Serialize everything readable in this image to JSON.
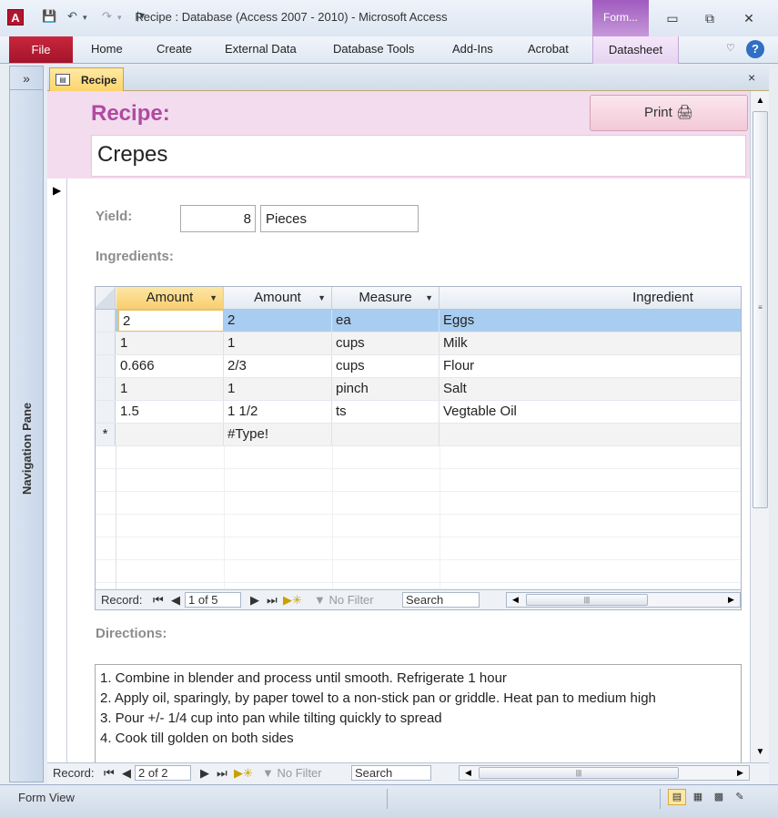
{
  "window": {
    "title": "Recipe : Database (Access 2007 - 2010)  -  Microsoft Access",
    "context_tab_group": "Form...",
    "app_icon": "A"
  },
  "ribbon": {
    "file_tab": "File",
    "tabs": [
      "Home",
      "Create",
      "External Data",
      "Database Tools",
      "Add-Ins",
      "Acrobat",
      "Datasheet"
    ]
  },
  "nav_pane": {
    "toggle": "»",
    "label": "Navigation Pane"
  },
  "document_tab": {
    "label": "Recipe",
    "close": "×"
  },
  "form": {
    "header_title": "Recipe:",
    "print_label": "Print",
    "recipe_name": "Crepes",
    "yield_label": "Yield:",
    "yield_amount": "8",
    "yield_unit": "Pieces",
    "ingredients_label": "Ingredients:",
    "directions_label": "Directions:",
    "directions_lines": [
      "1. Combine in blender and process until smooth.  Refrigerate 1 hour",
      "2. Apply oil, sparingly, by paper towel to a non-stick pan or griddle.  Heat pan to medium high",
      "3. Pour +/- 1/4 cup into pan while tilting quickly to spread",
      "4. Cook till golden on both sides"
    ]
  },
  "ingredients_grid": {
    "columns": [
      "Amount",
      "Amount",
      "Measure",
      "Ingredient"
    ],
    "rows": [
      [
        "2",
        "2",
        "ea",
        "Eggs"
      ],
      [
        "1",
        "1",
        "cups",
        "Milk"
      ],
      [
        "0.666",
        "2/3",
        "cups",
        "Flour"
      ],
      [
        "1",
        "1",
        "pinch",
        "Salt"
      ],
      [
        "1.5",
        "1 1/2",
        "ts",
        "Vegtable Oil"
      ]
    ],
    "new_row_marker": "*",
    "new_row_value": "#Type!",
    "nav": {
      "record_label": "Record:",
      "position": "1 of 5",
      "filter": "No Filter",
      "search": "Search"
    }
  },
  "main_nav": {
    "record_label": "Record:",
    "position": "2 of 2",
    "filter": "No Filter",
    "search": "Search"
  },
  "status": {
    "text": "Form View"
  },
  "colors": {
    "file_tab": "#b3152e",
    "form_header": "#f2dcee",
    "title_accent": "#b04aa0",
    "selected_row": "#a9cdf0"
  }
}
